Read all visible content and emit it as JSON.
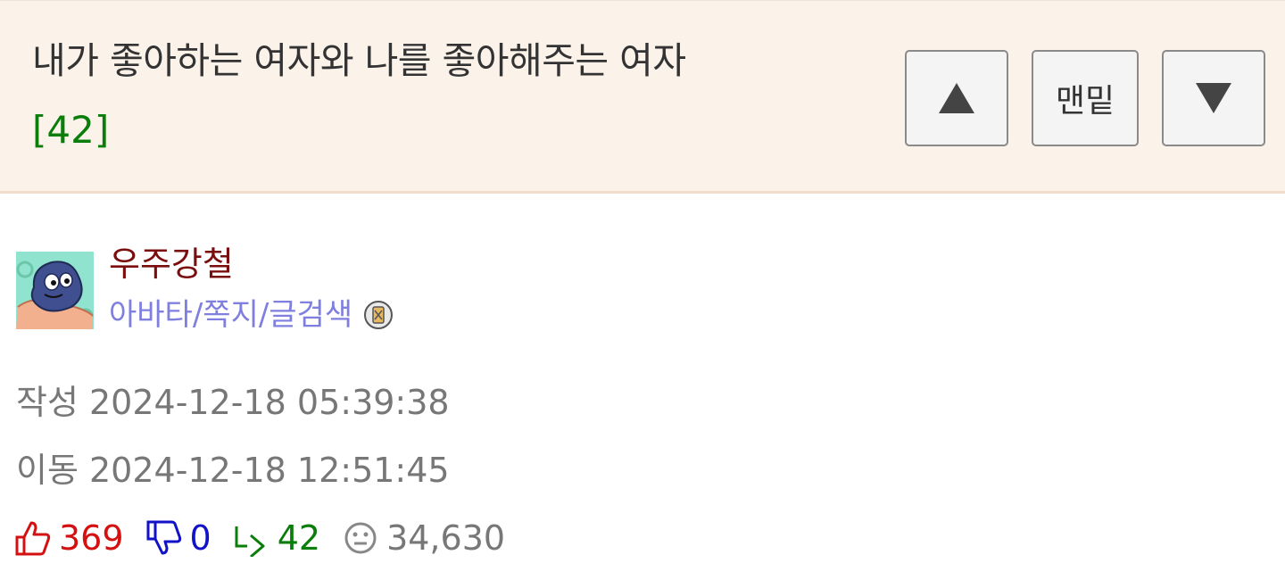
{
  "post": {
    "title": "내가 좋아하는 여자와 나를 좋아해주는 여자",
    "comment_count": "[42]"
  },
  "nav": {
    "bottom_label": "맨밑",
    "up_icon": "triangle-up-icon",
    "down_icon": "triangle-down-icon"
  },
  "author": {
    "name": "우주강철",
    "links": "아바타/쪽지/글검색",
    "badge_icon": "level-badge-icon"
  },
  "meta": {
    "written": "작성 2024-12-18 05:39:38",
    "moved": "이동 2024-12-18 12:51:45"
  },
  "stats": {
    "likes": "369",
    "dislikes": "0",
    "replies": "42",
    "views": "34,630"
  },
  "colors": {
    "header_bg": "#fbf2ea",
    "comment_count": "#0a7d0a",
    "author_name": "#7a0d0d",
    "author_links": "#7f7fe0",
    "likes": "#d41010",
    "dislikes": "#1212c8",
    "replies": "#0a7d0a",
    "meta": "#777777"
  }
}
